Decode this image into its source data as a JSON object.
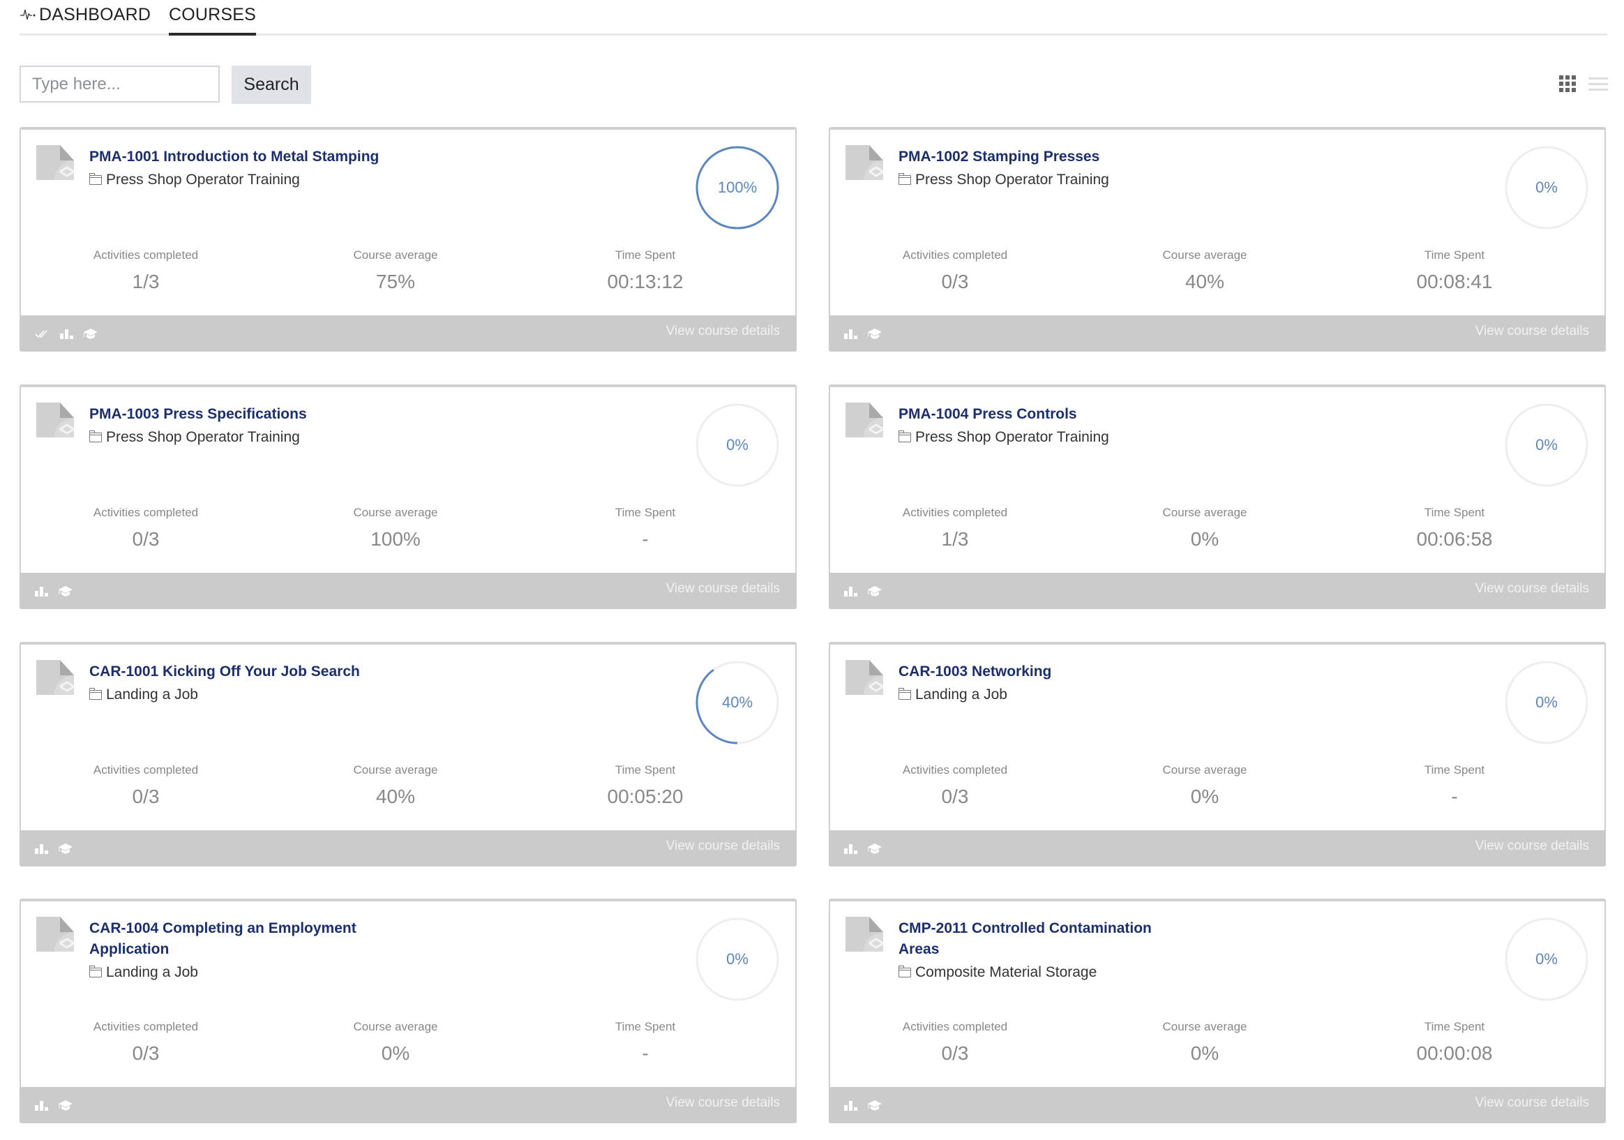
{
  "tabs": {
    "dashboard": {
      "label": "DASHBOARD",
      "icon": "pulse-icon"
    },
    "courses": {
      "label": "COURSES",
      "active": true
    }
  },
  "search": {
    "placeholder": "Type here...",
    "value": "",
    "button_label": "Search"
  },
  "view_toggle": {
    "grid_icon": "grid-view-icon",
    "list_icon": "list-view-icon",
    "active": "grid"
  },
  "colors": {
    "title": "#1b2f6e",
    "progress": "#5b87c0",
    "ring_track": "#eeeeee",
    "footer_bg": "#cbcbcb"
  },
  "stat_labels": {
    "activities": "Activities completed",
    "average": "Course average",
    "time": "Time Spent"
  },
  "footer_link_label": "View course details",
  "courses": [
    {
      "title": "PMA-1001 Introduction to Metal Stamping",
      "category": "Press Shop Operator Training",
      "progress": 100,
      "progress_label": "100%",
      "activities": "1/3",
      "average": "75%",
      "time": "00:13:12",
      "footer_icons": [
        "completed-check-icon",
        "bar-chart-icon",
        "graduation-cap-icon"
      ]
    },
    {
      "title": "PMA-1002 Stamping Presses",
      "category": "Press Shop Operator Training",
      "progress": 0,
      "progress_label": "0%",
      "activities": "0/3",
      "average": "40%",
      "time": "00:08:41",
      "footer_icons": [
        "bar-chart-icon",
        "graduation-cap-icon"
      ]
    },
    {
      "title": "PMA-1003 Press Specifications",
      "category": "Press Shop Operator Training",
      "progress": 0,
      "progress_label": "0%",
      "activities": "0/3",
      "average": "100%",
      "time": "-",
      "footer_icons": [
        "bar-chart-icon",
        "graduation-cap-icon"
      ]
    },
    {
      "title": "PMA-1004 Press Controls",
      "category": "Press Shop Operator Training",
      "progress": 0,
      "progress_label": "0%",
      "activities": "1/3",
      "average": "0%",
      "time": "00:06:58",
      "footer_icons": [
        "bar-chart-icon",
        "graduation-cap-icon"
      ]
    },
    {
      "title": "CAR-1001 Kicking Off Your Job Search",
      "category": "Landing a Job",
      "progress": 40,
      "progress_label": "40%",
      "activities": "0/3",
      "average": "40%",
      "time": "00:05:20",
      "footer_icons": [
        "bar-chart-icon",
        "graduation-cap-icon"
      ]
    },
    {
      "title": "CAR-1003 Networking",
      "category": "Landing a Job",
      "progress": 0,
      "progress_label": "0%",
      "activities": "0/3",
      "average": "0%",
      "time": "-",
      "footer_icons": [
        "bar-chart-icon",
        "graduation-cap-icon"
      ]
    },
    {
      "title": "CAR-1004 Completing an Employment Application",
      "category": "Landing a Job",
      "progress": 0,
      "progress_label": "0%",
      "activities": "0/3",
      "average": "0%",
      "time": "-",
      "footer_icons": [
        "bar-chart-icon",
        "graduation-cap-icon"
      ]
    },
    {
      "title": "CMP-2011 Controlled Contamination Areas",
      "category": "Composite Material Storage",
      "progress": 0,
      "progress_label": "0%",
      "activities": "0/3",
      "average": "0%",
      "time": "00:00:08",
      "footer_icons": [
        "bar-chart-icon",
        "graduation-cap-icon"
      ]
    }
  ]
}
